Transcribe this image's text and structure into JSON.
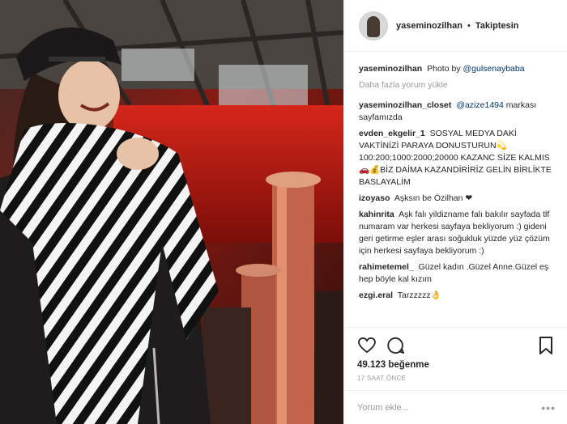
{
  "header": {
    "username": "yaseminozilhan",
    "separator": "•",
    "follow_status": "Takiptesin"
  },
  "caption": {
    "username": "yaseminozilhan",
    "text": "Photo by",
    "mention": "@gulsenaybaba"
  },
  "load_more": "Daha fazla yorum yükle",
  "comments": [
    {
      "username": "yaseminozilhan_closet",
      "mention": "@azize1494",
      "text": "markası sayfamızda"
    },
    {
      "username": "evden_ekgelir_1",
      "mention": "",
      "text": "SOSYAL MEDYA DAKİ VAKTİNİZİ PARAYA DONUSTURUN💫 100:200;1000:2000;20000 KAZANC SİZE KALMIS 🚗💰BİZ DAİMA KAZANDİRİRİZ GELİN BİRLİKTE BASLAYALİM"
    },
    {
      "username": "izoyaso",
      "mention": "",
      "text": "Aşksın be Özilhan ❤"
    },
    {
      "username": "kahinrita",
      "mention": "",
      "text": "Aşk falı yildizname falı bakılır sayfada tlf numaram var herkesi sayfaya bekliyorum :) gideni geri getirme eşler arası soğukluk yüzde yüz çözüm için herkesi sayfaya bekliyorum :)"
    },
    {
      "username": "rahimetemel_",
      "mention": "",
      "text": "Güzel kadın .Güzel Anne.Güzel eş hep böyle kal kızım"
    },
    {
      "username": "ezgi.eral",
      "mention": "",
      "text": "Tarzzzzz👌"
    }
  ],
  "likes_text": "49.123 beğenme",
  "time_ago": "17 SAAT ÖNCE",
  "add_comment_placeholder": "Yorum ekle...",
  "more_options": "•••",
  "icons": {
    "like": "heart-icon",
    "comment": "comment-bubble-icon",
    "save": "bookmark-icon"
  },
  "colors": {
    "text": "#262626",
    "muted": "#999999",
    "mention": "#003569",
    "border": "#efefef"
  }
}
